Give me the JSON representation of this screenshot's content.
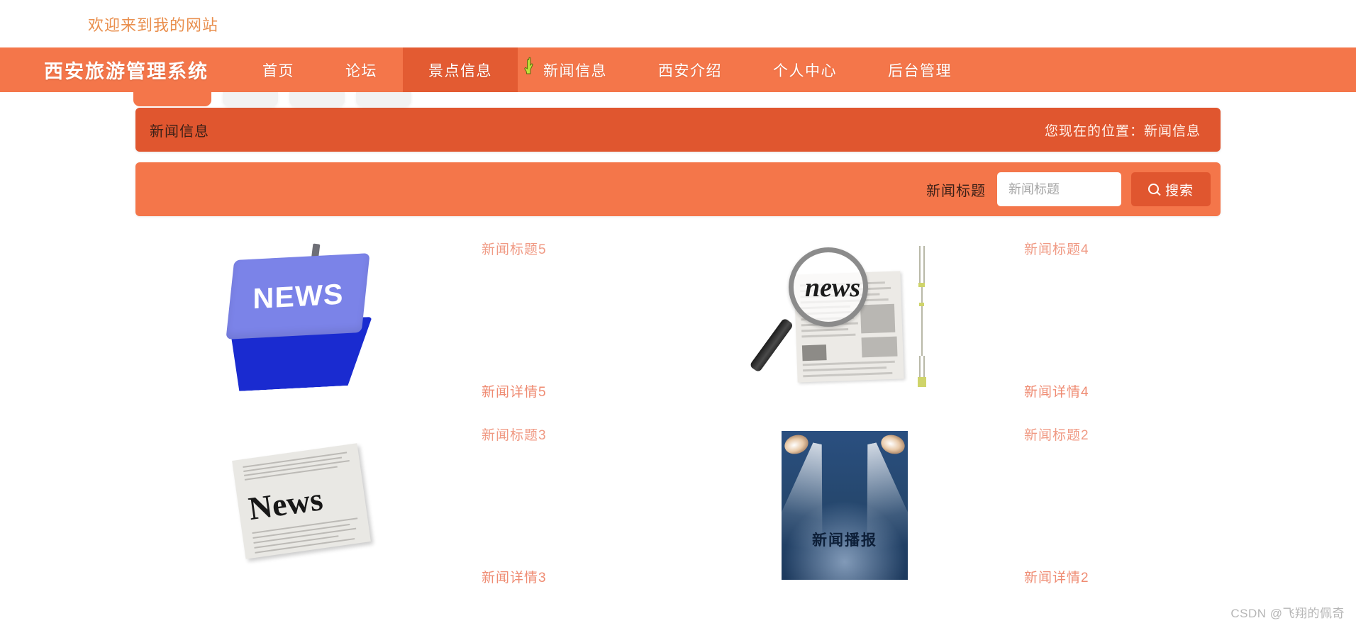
{
  "header": {
    "welcome_text": "欢迎来到我的网站"
  },
  "nav": {
    "brand": "西安旅游管理系统",
    "items": [
      {
        "label": "首页",
        "active": false
      },
      {
        "label": "论坛",
        "active": false
      },
      {
        "label": "景点信息",
        "active": true
      },
      {
        "label": "新闻信息",
        "active": false
      },
      {
        "label": "西安介绍",
        "active": false
      },
      {
        "label": "个人中心",
        "active": false
      },
      {
        "label": "后台管理",
        "active": false
      }
    ]
  },
  "breadcrumb": {
    "title": "新闻信息",
    "position": "您现在的位置：新闻信息"
  },
  "search": {
    "label": "新闻标题",
    "placeholder": "新闻标题",
    "value": "",
    "button_label": "搜索",
    "button_icon": "search-icon"
  },
  "news_list": [
    {
      "title": "新闻标题5",
      "detail": "新闻详情5",
      "thumb": "news-keyboard-key-image",
      "thumb_text": "NEWS"
    },
    {
      "title": "新闻标题4",
      "detail": "新闻详情4",
      "thumb": "magnifier-newspaper-image",
      "thumb_text": "news"
    },
    {
      "title": "新闻标题3",
      "detail": "新闻详情3",
      "thumb": "grey-newspaper-image",
      "thumb_text": "News"
    },
    {
      "title": "新闻标题2",
      "detail": "新闻详情2",
      "thumb": "spotlight-broadcast-image",
      "thumb_text": "新闻播报"
    }
  ],
  "watermark": "CSDN @飞翔的佩奇",
  "colors": {
    "brand_orange": "#f4764a",
    "accent_dark_orange": "#e0562f",
    "nav_active": "#e35b32",
    "news_link": "#f09a84",
    "welcome": "#e8863f"
  }
}
